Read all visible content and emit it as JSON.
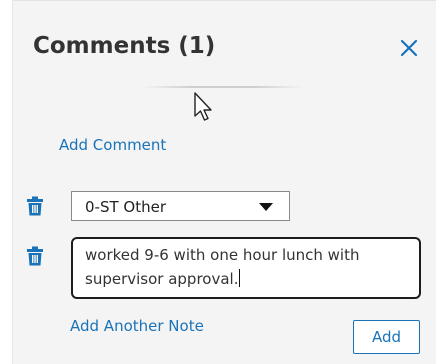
{
  "panel": {
    "title": "Comments (1)",
    "close_icon": "close-icon"
  },
  "add_comment_link": "Add Comment",
  "comment": {
    "type_select": {
      "selected": "0-ST Other"
    },
    "note_lines": [
      "worked 9-6 with one hour lunch with",
      "supervisor approval."
    ]
  },
  "add_another_note_link": "Add Another Note",
  "add_button": "Add",
  "colors": {
    "accent": "#1a73b8",
    "panel_bg": "#f4f4f4",
    "text": "#333333"
  },
  "icons": [
    "close-icon",
    "trash-icon",
    "dropdown-caret-icon",
    "mouse-cursor-icon"
  ]
}
